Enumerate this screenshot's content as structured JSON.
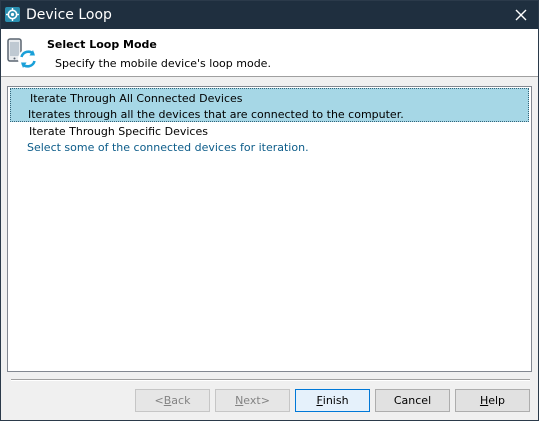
{
  "window": {
    "title": "Device Loop",
    "close_glyph": "✕"
  },
  "header": {
    "title": "Select Loop Mode",
    "subtitle": "Specify the mobile device's loop mode."
  },
  "modes": [
    {
      "title": "Iterate Through All Connected Devices",
      "description": "Iterates through all the devices that are connected to the computer.",
      "selected": true
    },
    {
      "title": "Iterate Through Specific Devices",
      "description": "Select some of the connected devices for iteration.",
      "selected": false
    }
  ],
  "buttons": {
    "back": {
      "mnemonic": "B",
      "rest": "ack",
      "prefix": "< ",
      "enabled": false
    },
    "next": {
      "mnemonic": "N",
      "rest": "ext",
      "suffix": " >",
      "enabled": false
    },
    "finish": {
      "mnemonic": "F",
      "rest": "inish",
      "enabled": true
    },
    "cancel": {
      "label": "Cancel",
      "enabled": true
    },
    "help": {
      "mnemonic": "H",
      "rest": "elp",
      "enabled": true
    }
  },
  "colors": {
    "titlebar": "#1f2f3f",
    "selection": "#a6d7e6",
    "description_text": "#0c5c89"
  }
}
